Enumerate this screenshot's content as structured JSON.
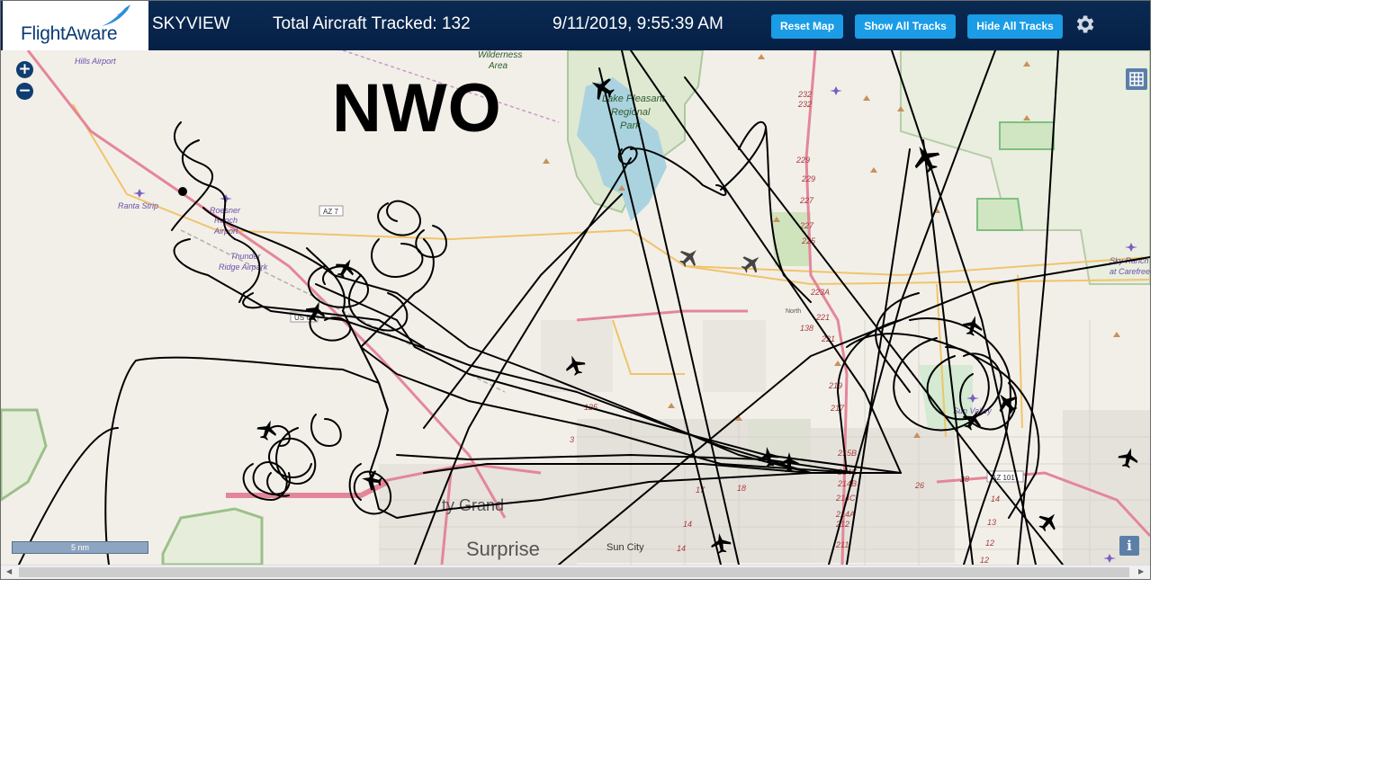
{
  "header": {
    "logo_text": "FlightAware",
    "product": "SKYVIEW",
    "aircraft_label": "Total Aircraft Tracked: 132",
    "datetime": "9/11/2019, 9:55:39 AM",
    "buttons": {
      "reset": "Reset Map",
      "show_tracks": "Show All Tracks",
      "hide_tracks": "Hide All Tracks"
    },
    "settings_icon": "gear-icon"
  },
  "map": {
    "overlay_label": "NWO",
    "zoom_in": "+",
    "zoom_out": "−",
    "scale": "5 nm",
    "info": "i",
    "labels": {
      "wilderness": [
        "Wilderness",
        "Area"
      ],
      "hills_airport": "Hills Airport",
      "lake_pleasant": [
        "Lake Pleasant",
        "Regional",
        "Park"
      ],
      "ranta": "Ranta Strip",
      "roesner": [
        "Roesner",
        "Ranch",
        "Airport"
      ],
      "thunder": [
        "Thunder",
        "Ridge Airpark"
      ],
      "sky_ranch": [
        "Sky Ranch",
        "at Carefree"
      ],
      "sun_valley": "Sun Valley",
      "grand": "ty Grand",
      "surprise": "Surprise",
      "sun_city": "Sun City",
      "north": "North",
      "az7": "AZ 7",
      "us60": "US 60",
      "az101": "AZ 101"
    },
    "mile_markers": [
      "232",
      "232",
      "229",
      "229",
      "227",
      "227",
      "225",
      "223A",
      "221",
      "221",
      "219",
      "217",
      "215B",
      "214C",
      "214B",
      "214C",
      "214A",
      "212",
      "211",
      "28",
      "26",
      "14",
      "13",
      "12",
      "12",
      "138",
      "125",
      "3",
      "14",
      "14",
      "18",
      "17"
    ]
  },
  "colors": {
    "header_bg": "#062046",
    "button": "#1b9ce6",
    "map_bg": "#f2efe9",
    "park_fill": "#cde6c0",
    "water": "#aad3df",
    "highway": "#e4869a",
    "track": "#000000"
  }
}
